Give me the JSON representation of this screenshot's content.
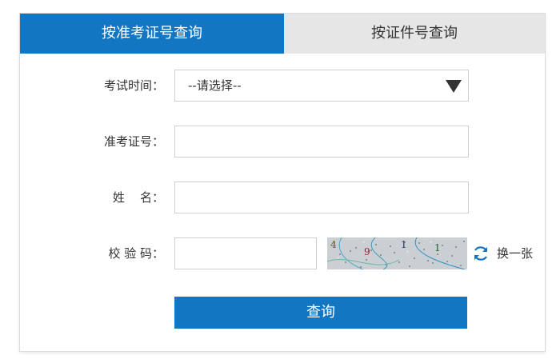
{
  "tabs": [
    {
      "label": "按准考证号查询",
      "active": true
    },
    {
      "label": "按证件号查询",
      "active": false
    }
  ],
  "form": {
    "exam_time": {
      "label": "考试时间：",
      "selected": "--请选择--"
    },
    "ticket_number": {
      "label": "准考证号：",
      "value": ""
    },
    "name": {
      "label": "姓    名：",
      "value": ""
    },
    "captcha": {
      "label": "校 验 码：",
      "value": "",
      "image_chars": [
        "4",
        "9",
        "1",
        "1"
      ],
      "refresh_label": "换一张"
    },
    "submit_label": "查询"
  },
  "colors": {
    "primary": "#1376c2",
    "tab_inactive": "#e6e6e6",
    "border": "#cfcfcf",
    "text": "#333333"
  },
  "icons": {
    "select_arrow": "triangle-down-icon",
    "refresh": "refresh-icon"
  }
}
